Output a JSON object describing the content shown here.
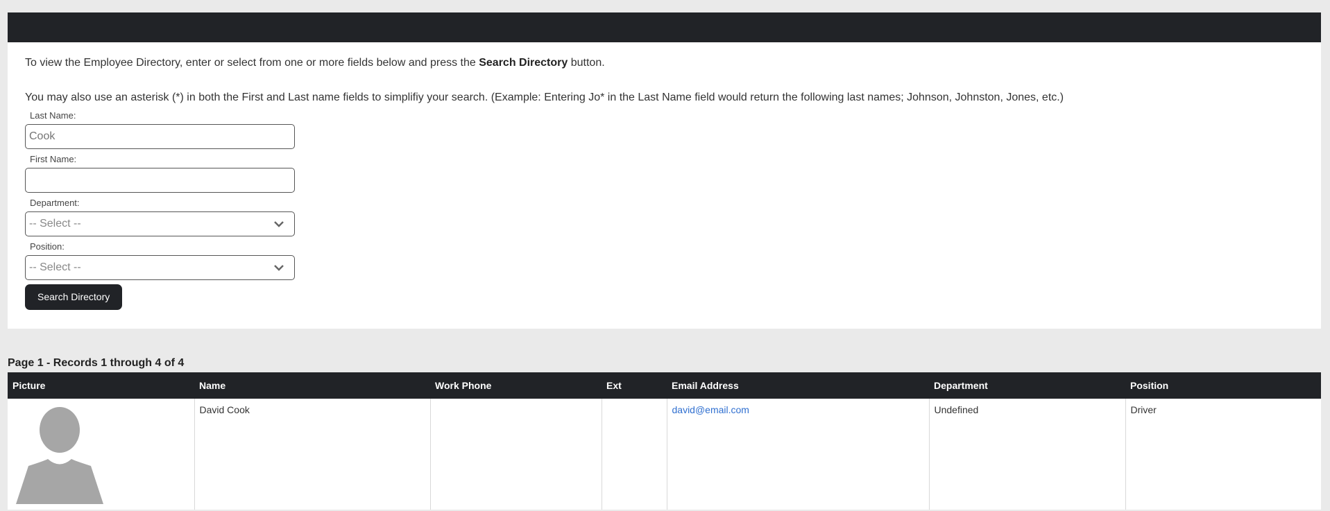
{
  "intro": {
    "line1_prefix": "To view the Employee Directory, enter or select from one or more fields below and press the ",
    "line1_bold": "Search Directory",
    "line1_suffix": " button.",
    "line2": "You may also use an asterisk (*) in both the First and Last name fields to simplifiy your search. (Example: Entering Jo* in the Last Name field would return the following last names; Johnson, Johnston, Jones, etc.)"
  },
  "form": {
    "last_name_label": "Last Name:",
    "last_name_placeholder": "Cook",
    "first_name_label": "First Name:",
    "first_name_value": "",
    "department_label": "Department:",
    "department_selected": "-- Select --",
    "position_label": "Position:",
    "position_selected": "-- Select --",
    "search_button": "Search Directory"
  },
  "results": {
    "summary": "Page 1 - Records 1 through 4 of 4",
    "columns": [
      "Picture",
      "Name",
      "Work Phone",
      "Ext",
      "Email Address",
      "Department",
      "Position"
    ],
    "rows": [
      {
        "picture": "avatar-placeholder",
        "name": "David Cook",
        "work_phone": "",
        "ext": "",
        "email": "david@email.com",
        "department": "Undefined",
        "position": "Driver"
      }
    ]
  },
  "colors": {
    "dark_bar": "#212327",
    "link": "#2f6fd0",
    "page_bg": "#eaeaea"
  },
  "icons": [
    "chevron-down-icon",
    "avatar-icon"
  ]
}
